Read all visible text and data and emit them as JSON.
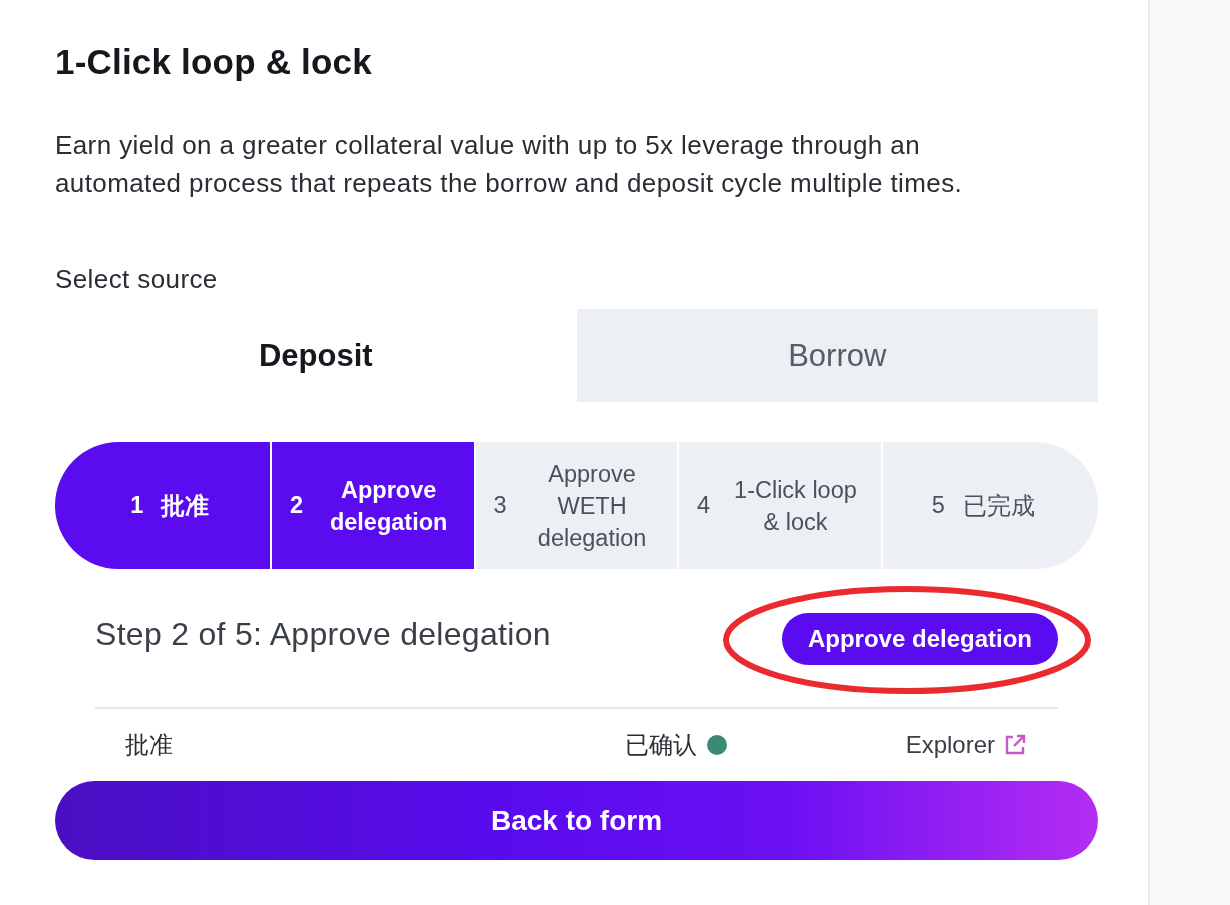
{
  "title": "1-Click loop & lock",
  "description": "Earn yield on a greater collateral value with up to 5x leverage through an automated process that repeats the borrow and deposit cycle multiple times.",
  "source": {
    "label": "Select source",
    "tabs": [
      {
        "label": "Deposit",
        "selected": true
      },
      {
        "label": "Borrow",
        "selected": false
      }
    ]
  },
  "steps": [
    {
      "number": "1",
      "label": "批准",
      "active": true
    },
    {
      "number": "2",
      "label": "Approve delegation",
      "active": true
    },
    {
      "number": "3",
      "label": "Approve WETH delegation",
      "active": false
    },
    {
      "number": "4",
      "label": "1-Click loop & lock",
      "active": false
    },
    {
      "number": "5",
      "label": "已完成",
      "active": false
    }
  ],
  "current_step": {
    "heading": "Step 2 of 5: Approve delegation",
    "action": {
      "label": "Approve delegation",
      "circled": true
    }
  },
  "transactions": [
    {
      "name": "批准",
      "status": "已确认",
      "color": "#3b8a76",
      "link": "Explorer"
    }
  ],
  "back_button": "Back to form"
}
